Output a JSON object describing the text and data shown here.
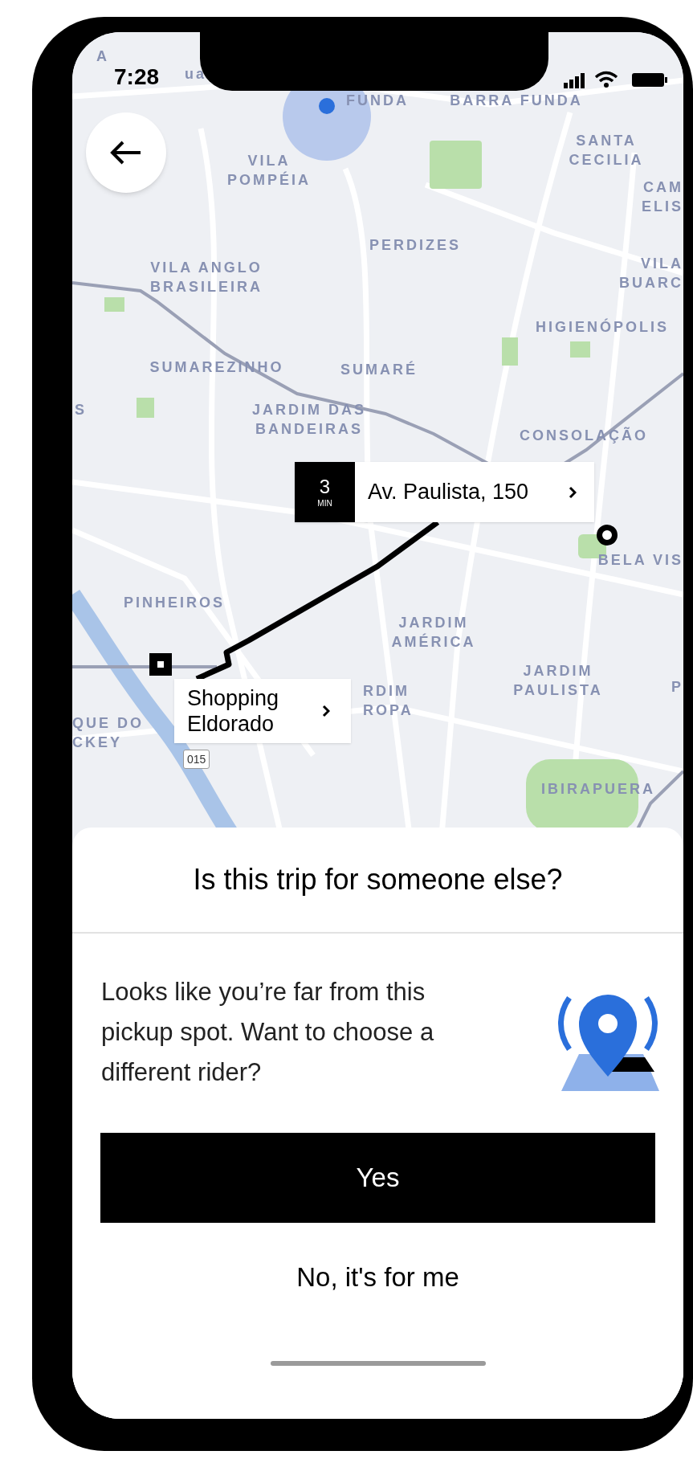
{
  "status_bar": {
    "time": "7:28"
  },
  "map": {
    "labels": [
      "A",
      "ua",
      "FUNDA",
      "BARRA FUNDA",
      "VILA\nPOMPÉIA",
      "SANTA\nCECILIA",
      "CAM\nELIS",
      "PERDIZES",
      "VILA ANGLO\nBRASILEIRA",
      "VILA\nBUARC",
      "HIGIENÓPOLIS",
      "SUMAREZINHO",
      "SUMARÉ",
      "S",
      "JARDIM DAS\nBANDEIRAS",
      "CONSOLAÇÃO",
      "BELA VIS",
      "PINHEIROS",
      "JARDIM\nAMÉRICA",
      "RDIM\nROPA",
      "JARDIM\nPAULISTA",
      "P",
      "QUE DO\nCKEY",
      "IBIRAPUERA"
    ],
    "road_shield": "015"
  },
  "route": {
    "destination": {
      "eta_value": "3",
      "eta_unit": "MIN",
      "address": "Av. Paulista, 150"
    },
    "origin": {
      "name": "Shopping Eldorado"
    }
  },
  "sheet": {
    "title": "Is this trip for someone else?",
    "message": "Looks like you’re far from this pickup spot. Want to choose a different rider?",
    "buttons": [
      {
        "label": "Yes",
        "kind": "primary"
      },
      {
        "label": "No, it's for me",
        "kind": "secondary"
      }
    ]
  }
}
